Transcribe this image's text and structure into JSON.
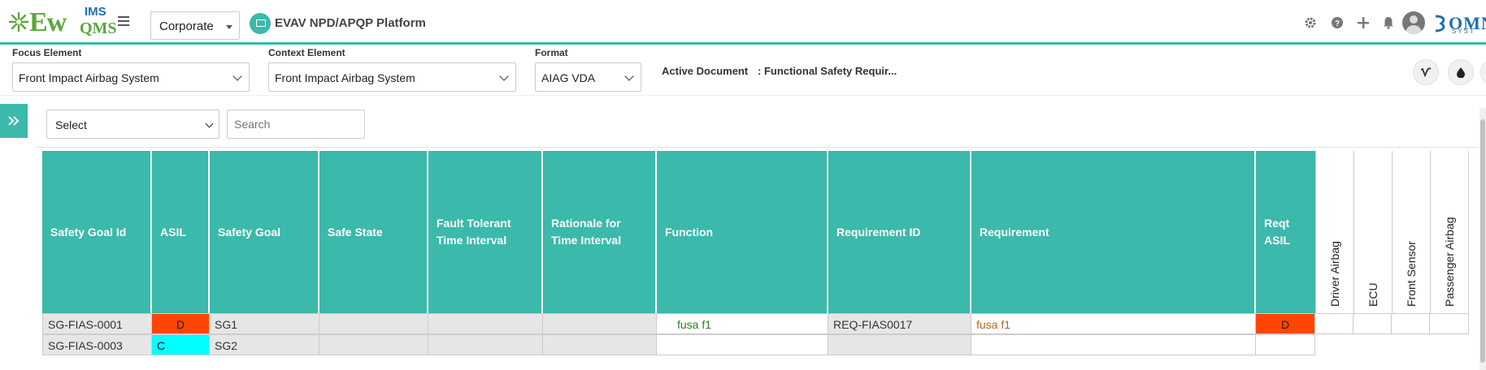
{
  "header": {
    "logo": {
      "ew": "Ew",
      "ims": "IMS",
      "qms": "QMS"
    },
    "company_select": "Corporate",
    "platform_title": "EVAV NPD/APQP Platform",
    "icons": [
      "gear-icon",
      "help-icon",
      "plus-icon",
      "bell-icon",
      "avatar",
      "omni-logo"
    ],
    "omni_logo": {
      "text": "OMN",
      "sub": "SYST"
    }
  },
  "filters": {
    "focus_label": "Focus Element",
    "focus_value": "Front Impact Airbag System",
    "context_label": "Context Element",
    "context_value": "Front Impact Airbag System",
    "format_label": "Format",
    "format_value": "AIAG VDA",
    "active_doc_label": "Active Document",
    "active_doc_value": ": Functional Safety Requir..."
  },
  "toolbar": {
    "select_value": "Select",
    "search_placeholder": "Search"
  },
  "colors": {
    "accent": "#3bb9aa",
    "asil_d": "#ff4500",
    "asil_c": "#00ffff",
    "function_text": "#2e7d1f",
    "requirement_text": "#b5651d"
  },
  "table": {
    "columns": [
      "Safety Goal Id",
      "ASIL",
      "Safety Goal",
      "Safe State",
      "Fault Tolerant Time Interval",
      "Rationale for Time Interval",
      "Function",
      "Requirement ID",
      "Requirement",
      "Reqt ASIL"
    ],
    "vertical_columns": [
      "Driver Airbag",
      "ECU",
      "Front Sensor",
      "Passenger Airbag"
    ],
    "rows": [
      {
        "safety_goal_id": "SG-FIAS-0001",
        "asil": "D",
        "safety_goal": "SG1",
        "safe_state": "",
        "ftti": "",
        "rationale": "",
        "function": "fusa f1",
        "requirement_id": "REQ-FIAS0017",
        "requirement": "fusa f1",
        "reqt_asil": "D"
      },
      {
        "safety_goal_id": "SG-FIAS-0003",
        "asil": "C",
        "safety_goal": "SG2",
        "safe_state": "",
        "ftti": "",
        "rationale": "",
        "function": "",
        "requirement_id": "",
        "requirement": "",
        "reqt_asil": ""
      }
    ]
  }
}
